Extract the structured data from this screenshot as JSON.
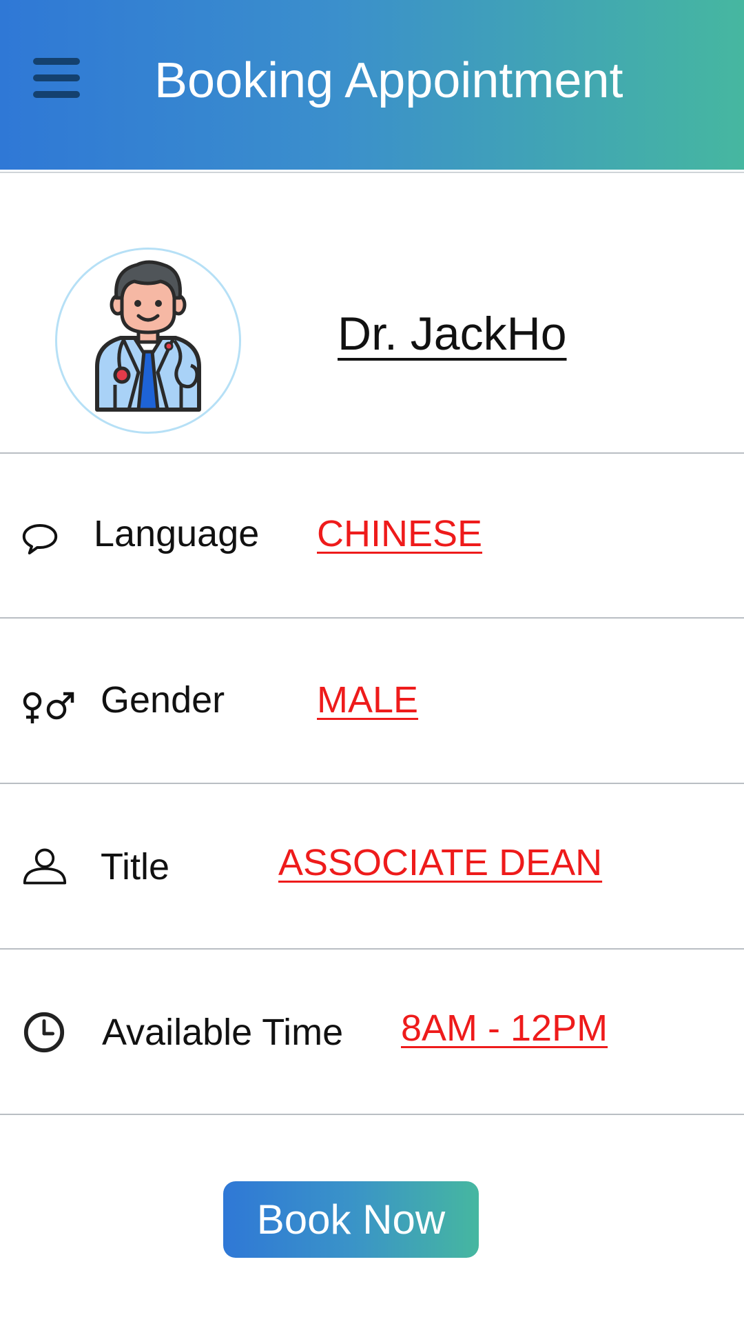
{
  "header": {
    "title": "Booking Appointment",
    "gradient_start": "#2f78d6",
    "gradient_end": "#46b7a0",
    "menu_icon": "hamburger-menu-icon"
  },
  "doctor": {
    "name": "Dr. JackHo",
    "avatar_icon": "doctor-avatar-icon",
    "avatar_ring_color": "#b6e0f6"
  },
  "details": [
    {
      "icon": "speech-bubble-icon",
      "label": "Language",
      "value": "CHINESE"
    },
    {
      "icon": "gender-icon",
      "label": "Gender",
      "value": "MALE"
    },
    {
      "icon": "person-icon",
      "label": "Title",
      "value": "ASSOCIATE DEAN"
    },
    {
      "icon": "clock-icon",
      "label": "Available Time",
      "value": "8AM - 12PM"
    }
  ],
  "value_color": "#ee1b1b",
  "actions": {
    "book_label": "Book Now"
  }
}
